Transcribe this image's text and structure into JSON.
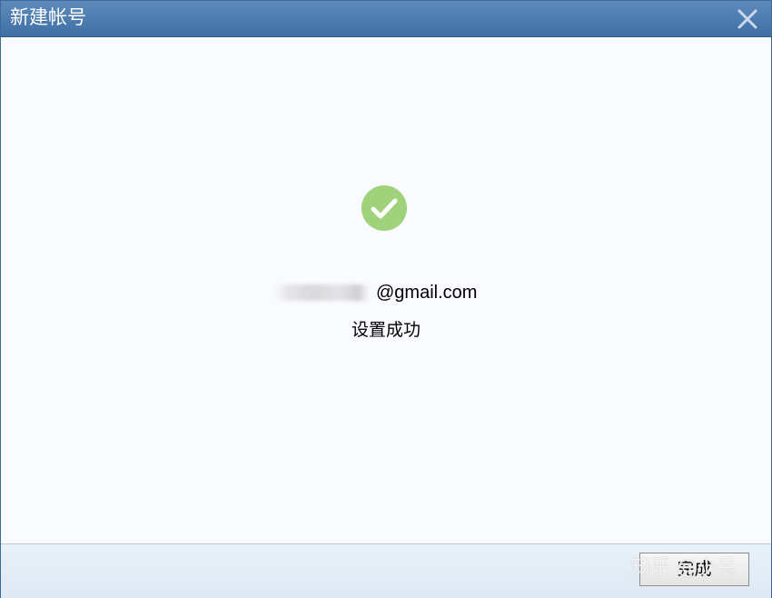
{
  "window": {
    "title": "新建帐号",
    "close_icon": "close-icon"
  },
  "main": {
    "status_icon": "check-circle-icon",
    "status_icon_color": "#9fd27a",
    "email_domain": "@gmail.com",
    "status_text": "设置成功"
  },
  "footer": {
    "done_label": "完成"
  },
  "watermark": {
    "text": "知乎 @小呆"
  }
}
